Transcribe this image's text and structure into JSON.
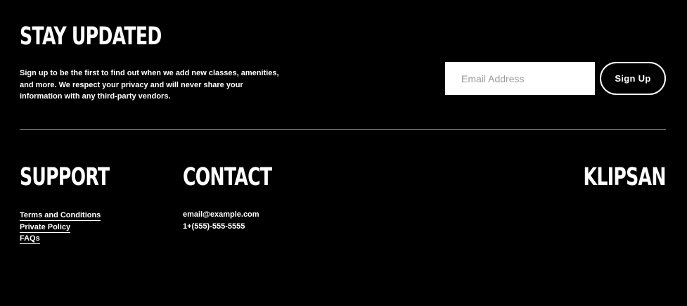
{
  "newsletter": {
    "title": "STAY UPDATED",
    "description": "Sign up to be the first to find out when we add new classes, amenities, and more. We respect your privacy and will never share your information with any third-party vendors.",
    "email_placeholder": "Email Address",
    "button_label": "Sign Up"
  },
  "support": {
    "title": "SUPPORT",
    "links": [
      {
        "label": "Terms and Conditions"
      },
      {
        "label": "Private Policy"
      },
      {
        "label": "FAQs"
      }
    ]
  },
  "contact": {
    "title": "CONTACT",
    "email": "email@example.com",
    "phone": "1+(555)-555-5555"
  },
  "brand": {
    "name": "KLIPSAN"
  },
  "colors": {
    "background": "#000000",
    "text": "#ffffff",
    "divider": "#9b9b9b",
    "input_background": "#ffffff",
    "placeholder": "#9a9a9a"
  }
}
